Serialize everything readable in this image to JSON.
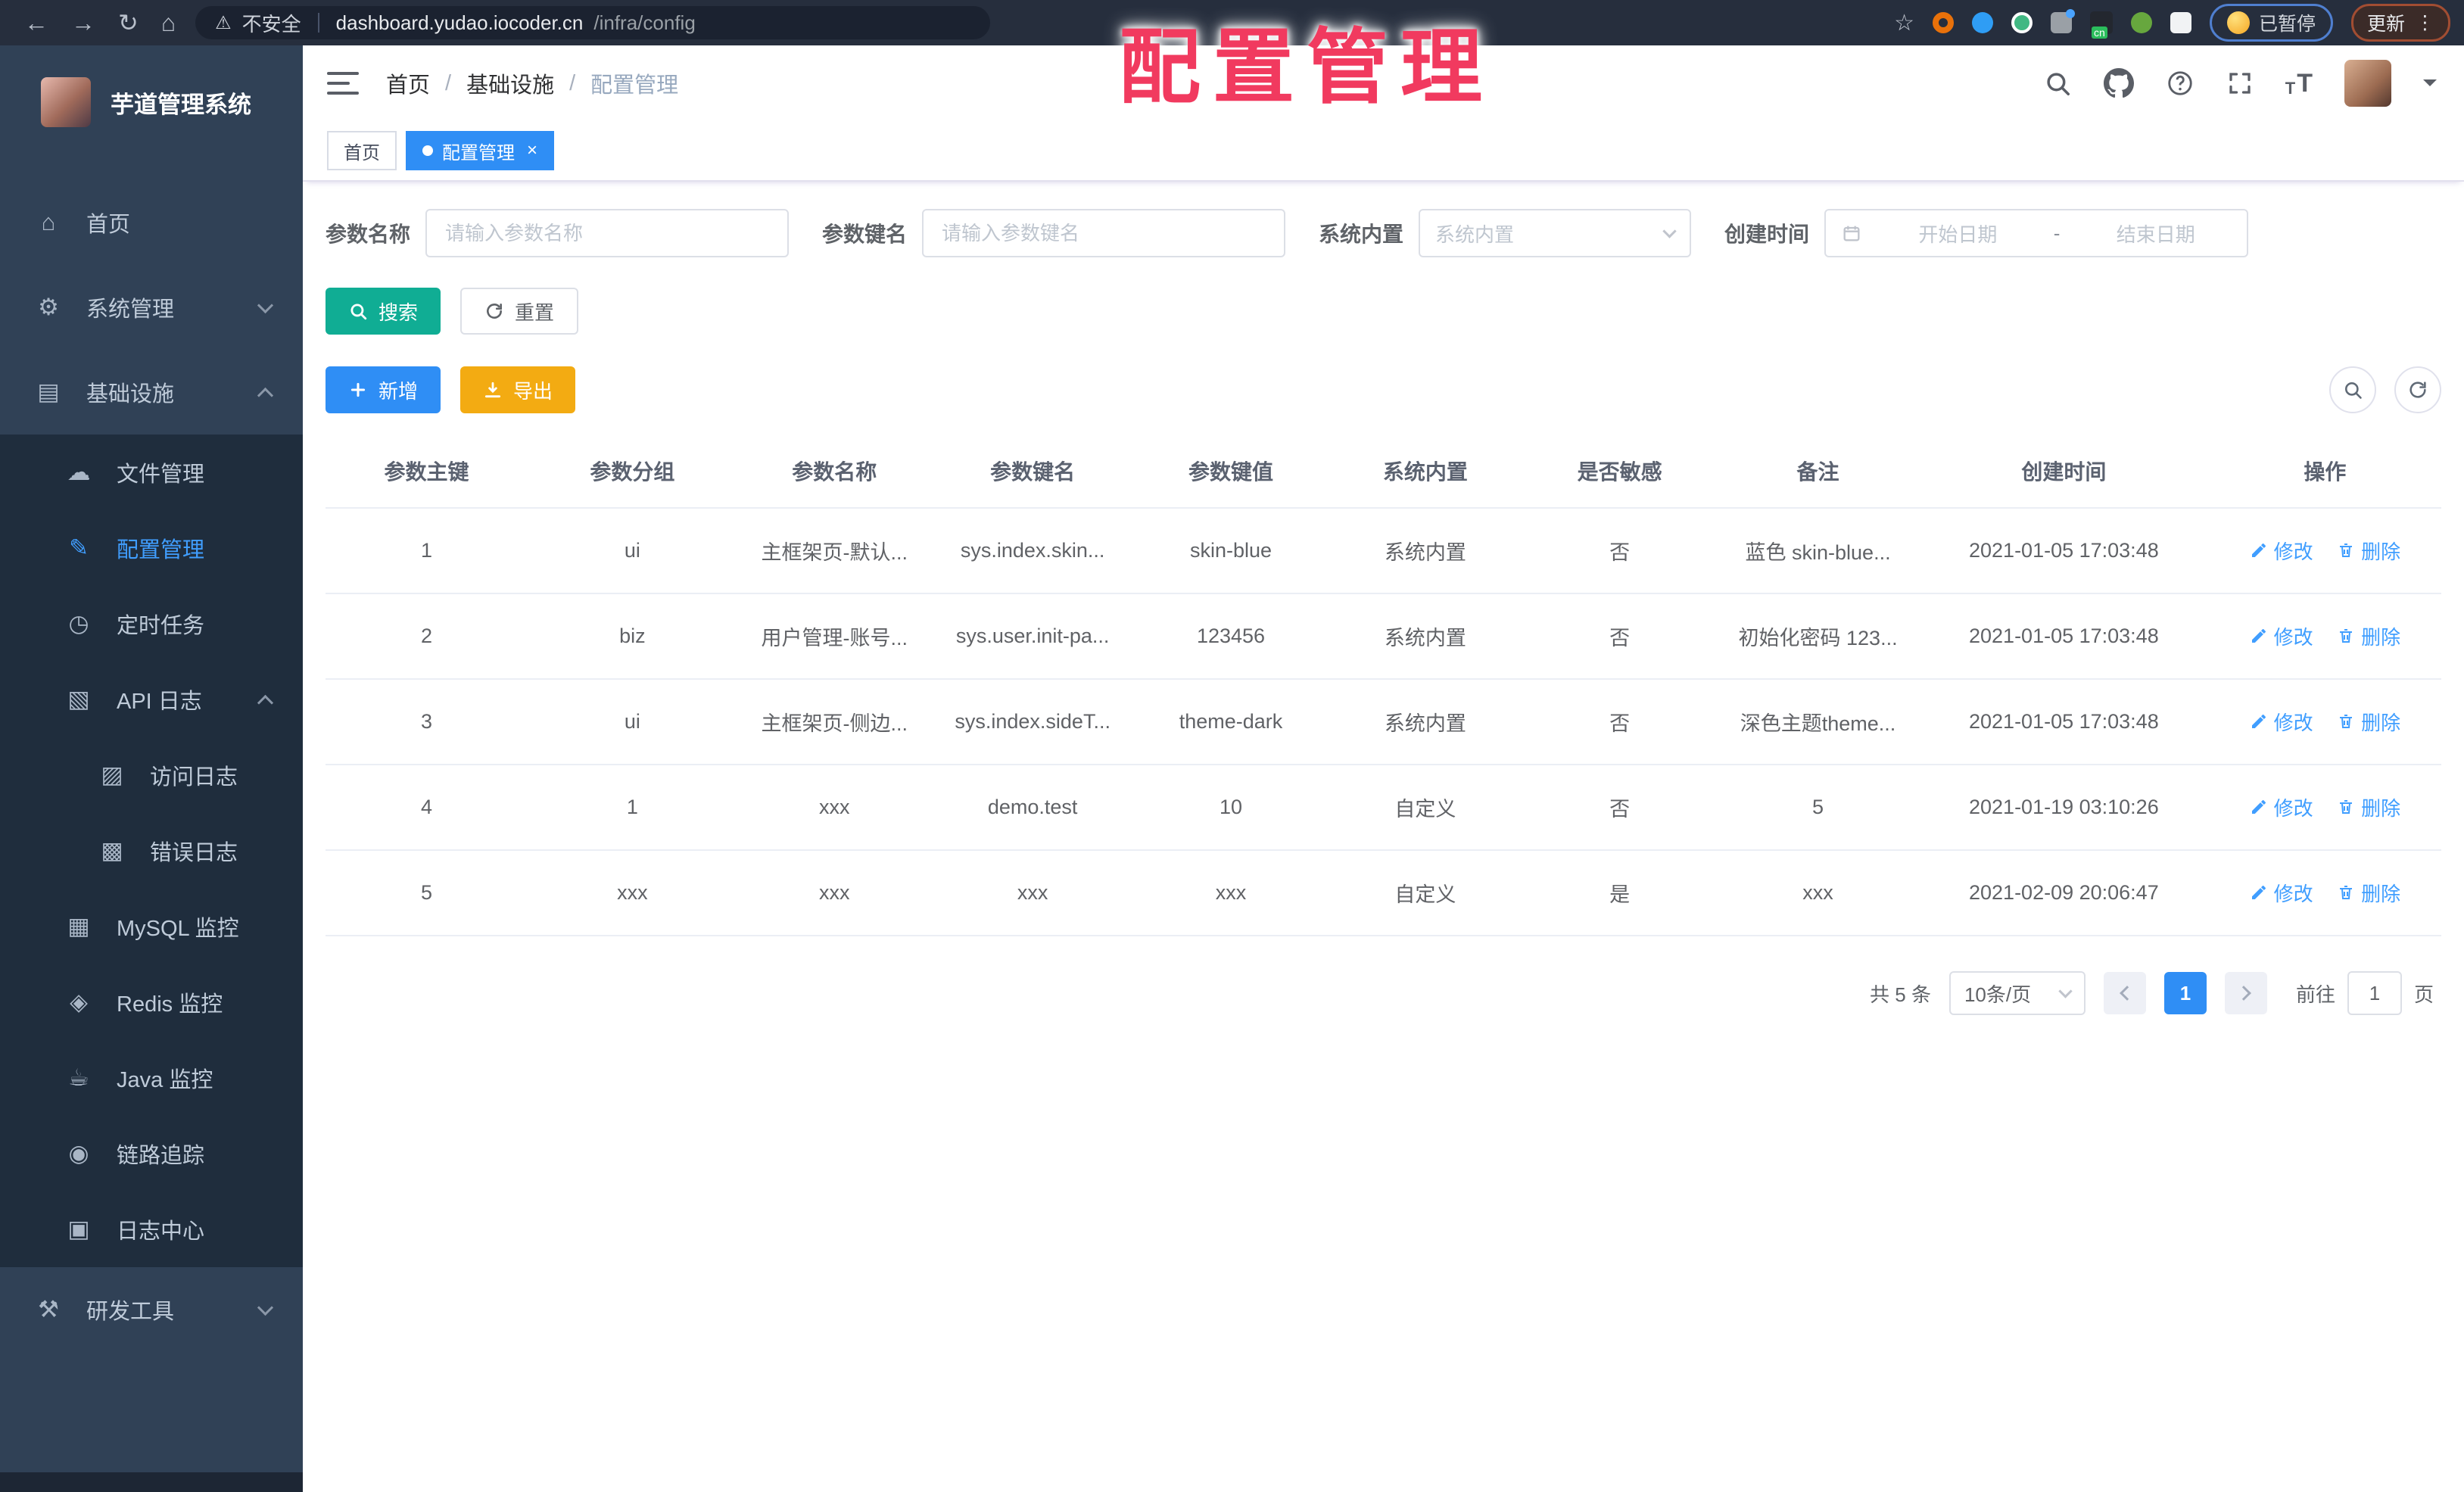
{
  "browser": {
    "security_label": "不安全",
    "url_host": "dashboard.yudao.iocoder.cn",
    "url_path": "/infra/config",
    "paused_badge": "已暂停",
    "update_button": "更新",
    "cn_badge": "cn"
  },
  "icons": {
    "back": "←",
    "forward": "→",
    "reload": "↻",
    "home": "⌂",
    "warning": "⚠",
    "star": "☆",
    "menu_dots": "⋮",
    "close": "×",
    "t_small": "T",
    "t_large": "T"
  },
  "overlay": {
    "title": "配置管理"
  },
  "sidebar": {
    "app_title": "芋道管理系统",
    "items": [
      {
        "icon": "⌂",
        "label": "首页"
      },
      {
        "icon": "⚙",
        "label": "系统管理"
      },
      {
        "icon": "▤",
        "label": "基础设施"
      },
      {
        "icon": "☁",
        "label": "文件管理"
      },
      {
        "icon": "✎",
        "label": "配置管理"
      },
      {
        "icon": "◷",
        "label": "定时任务"
      },
      {
        "icon": "▧",
        "label": "API 日志"
      },
      {
        "icon": "▨",
        "label": "访问日志"
      },
      {
        "icon": "▩",
        "label": "错误日志"
      },
      {
        "icon": "▦",
        "label": "MySQL 监控"
      },
      {
        "icon": "◈",
        "label": "Redis 监控"
      },
      {
        "icon": "☕",
        "label": "Java 监控"
      },
      {
        "icon": "◉",
        "label": "链路追踪"
      },
      {
        "icon": "▣",
        "label": "日志中心"
      },
      {
        "icon": "⚒",
        "label": "研发工具"
      }
    ]
  },
  "breadcrumb": {
    "items": [
      "首页",
      "基础设施",
      "配置管理"
    ],
    "separator": "/"
  },
  "tabs": [
    {
      "label": "首页"
    },
    {
      "label": "配置管理"
    }
  ],
  "filters": {
    "param_name": {
      "label": "参数名称",
      "placeholder": "请输入参数名称"
    },
    "param_key": {
      "label": "参数键名",
      "placeholder": "请输入参数键名"
    },
    "builtin": {
      "label": "系统内置",
      "placeholder": "系统内置"
    },
    "create_time": {
      "label": "创建时间",
      "start_placeholder": "开始日期",
      "separator": "-",
      "end_placeholder": "结束日期"
    }
  },
  "buttons": {
    "search": "搜索",
    "reset": "重置",
    "add": "新增",
    "export": "导出"
  },
  "table": {
    "columns": [
      "参数主键",
      "参数分组",
      "参数名称",
      "参数键名",
      "参数键值",
      "系统内置",
      "是否敏感",
      "备注",
      "创建时间",
      "操作"
    ],
    "edit_label": "修改",
    "delete_label": "删除",
    "rows": [
      {
        "id": "1",
        "group": "ui",
        "name": "主框架页-默认...",
        "key": "sys.index.skin...",
        "value": "skin-blue",
        "builtin": "系统内置",
        "sensitive": "否",
        "remark": "蓝色 skin-blue...",
        "created": "2021-01-05 17:03:48"
      },
      {
        "id": "2",
        "group": "biz",
        "name": "用户管理-账号...",
        "key": "sys.user.init-pa...",
        "value": "123456",
        "builtin": "系统内置",
        "sensitive": "否",
        "remark": "初始化密码 123...",
        "created": "2021-01-05 17:03:48"
      },
      {
        "id": "3",
        "group": "ui",
        "name": "主框架页-侧边...",
        "key": "sys.index.sideT...",
        "value": "theme-dark",
        "builtin": "系统内置",
        "sensitive": "否",
        "remark": "深色主题theme...",
        "created": "2021-01-05 17:03:48"
      },
      {
        "id": "4",
        "group": "1",
        "name": "xxx",
        "key": "demo.test",
        "value": "10",
        "builtin": "自定义",
        "sensitive": "否",
        "remark": "5",
        "created": "2021-01-19 03:10:26"
      },
      {
        "id": "5",
        "group": "xxx",
        "name": "xxx",
        "key": "xxx",
        "value": "xxx",
        "builtin": "自定义",
        "sensitive": "是",
        "remark": "xxx",
        "created": "2021-02-09 20:06:47"
      }
    ]
  },
  "pagination": {
    "total": "共 5 条",
    "page_size": "10条/页",
    "current_page": "1",
    "goto_label": "前往",
    "goto_value": "1",
    "page_suffix": "页"
  },
  "colors": {
    "accent_blue": "#2f8ef5",
    "link_blue": "#409EFF",
    "search_teal": "#10ad94",
    "export_yellow": "#f3ab12",
    "sidebar_bg": "#304156",
    "submenu_bg": "#1f2d3d",
    "overlay_red": "#f13a5f"
  }
}
